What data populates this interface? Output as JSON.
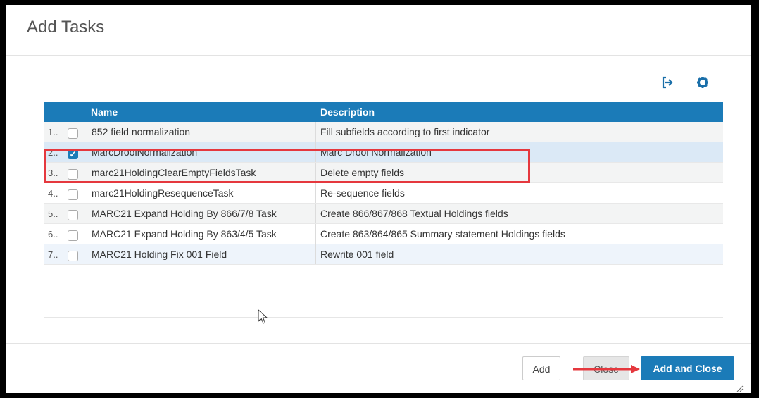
{
  "dialog": {
    "title": "Add Tasks"
  },
  "toolbar": {
    "icons": [
      "export-icon",
      "gear-icon"
    ]
  },
  "grid": {
    "columns": [
      "Name",
      "Description"
    ],
    "rows": [
      {
        "num": "1..",
        "checked": false,
        "name": "852 field normalization",
        "description": "Fill subfields according to first indicator"
      },
      {
        "num": "2..",
        "checked": true,
        "name": "MarcDroolNormalization",
        "description": "Marc Drool Normalization"
      },
      {
        "num": "3..",
        "checked": false,
        "name": "marc21HoldingClearEmptyFieldsTask",
        "description": "Delete empty fields"
      },
      {
        "num": "4..",
        "checked": false,
        "name": "marc21HoldingResequenceTask",
        "description": "Re-sequence fields"
      },
      {
        "num": "5..",
        "checked": false,
        "name": "MARC21 Expand Holding By 866/7/8 Task",
        "description": "Create 866/867/868 Textual Holdings fields"
      },
      {
        "num": "6..",
        "checked": false,
        "name": "MARC21 Expand Holding By 863/4/5 Task",
        "description": "Create 863/864/865 Summary statement Holdings fields"
      },
      {
        "num": "7..",
        "checked": false,
        "name": "MARC21 Holding Fix 001 Field",
        "description": "Rewrite 001 field"
      }
    ]
  },
  "footer": {
    "add_label": "Add",
    "close_label": "Close",
    "add_close_label": "Add and Close"
  },
  "colors": {
    "accent": "#1b7bb8",
    "highlight": "#e5383e"
  }
}
